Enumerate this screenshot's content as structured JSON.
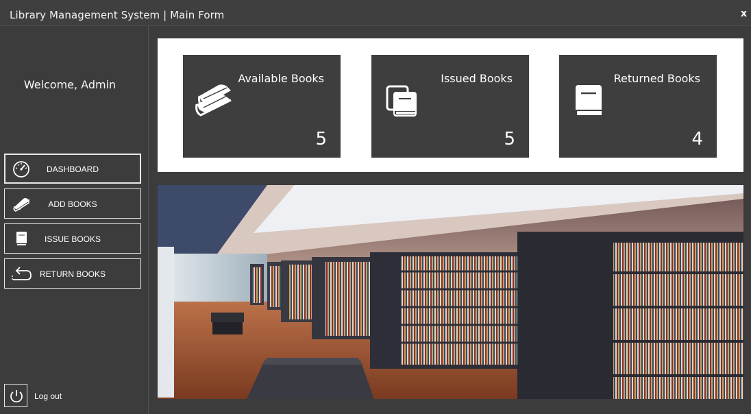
{
  "window": {
    "title": "Library Management System | Main Form",
    "close_label": "x"
  },
  "sidebar": {
    "welcome": "Welcome, Admin",
    "items": [
      {
        "label": "DASHBOARD",
        "icon": "speedometer-icon",
        "active": true
      },
      {
        "label": "ADD BOOKS",
        "icon": "book-icon",
        "active": false
      },
      {
        "label": "ISSUE BOOKS",
        "icon": "notebook-icon",
        "active": false
      },
      {
        "label": "RETURN BOOKS",
        "icon": "return-arrow-icon",
        "active": false
      }
    ],
    "logout": {
      "label": "Log out",
      "icon": "power-icon"
    }
  },
  "stats": [
    {
      "title": "Available Books",
      "count": "5",
      "icon": "books-stack-icon"
    },
    {
      "title": "Issued Books",
      "count": "5",
      "icon": "copy-book-icon"
    },
    {
      "title": "Returned Books",
      "count": "4",
      "icon": "closed-book-icon"
    }
  ],
  "colors": {
    "background": "#3c3c3c",
    "card": "#3e3e3e",
    "panel": "#ffffff",
    "text": "#ffffff"
  }
}
